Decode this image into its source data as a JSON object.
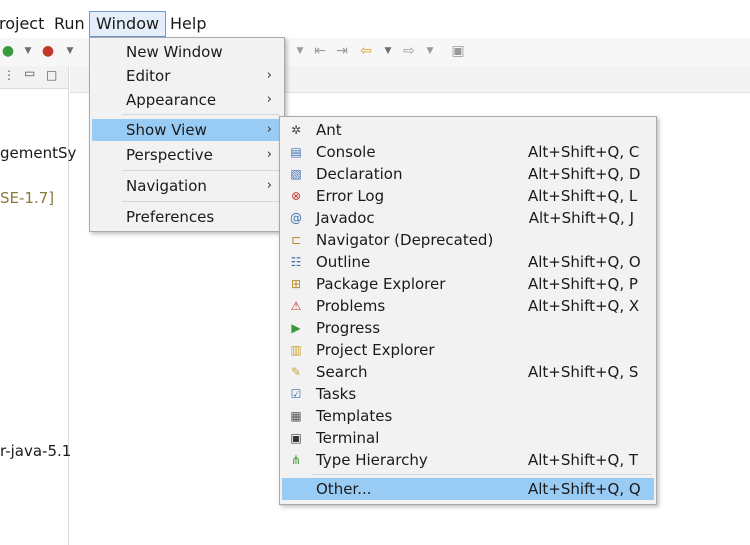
{
  "menubar": {
    "project": "roject",
    "run": "Run",
    "window": "Window",
    "help": "Help"
  },
  "left_texts": {
    "line1": "gementSy",
    "line2": "SE-1.7]",
    "line3": "r-java-5.1"
  },
  "window_menu": [
    {
      "label": "New Window",
      "submenu": false
    },
    {
      "label": "Editor",
      "submenu": true
    },
    {
      "label": "Appearance",
      "submenu": true
    },
    {
      "label": "Show View",
      "submenu": true,
      "selected": true
    },
    {
      "label": "Perspective",
      "submenu": true
    },
    {
      "label": "Navigation",
      "submenu": true
    },
    {
      "label": "Preferences",
      "submenu": false
    }
  ],
  "arrow_glyph": "›",
  "show_view_menu": [
    {
      "label": "Ant",
      "shortcut": "",
      "icon": "ant-icon"
    },
    {
      "label": "Console",
      "shortcut": "Alt+Shift+Q, C",
      "icon": "console-icon"
    },
    {
      "label": "Declaration",
      "shortcut": "Alt+Shift+Q, D",
      "icon": "declaration-icon"
    },
    {
      "label": "Error Log",
      "shortcut": "Alt+Shift+Q, L",
      "icon": "error-log-icon"
    },
    {
      "label": "Javadoc",
      "shortcut": "Alt+Shift+Q, J",
      "icon": "javadoc-icon"
    },
    {
      "label": "Navigator (Deprecated)",
      "shortcut": "",
      "icon": "navigator-icon"
    },
    {
      "label": "Outline",
      "shortcut": "Alt+Shift+Q, O",
      "icon": "outline-icon"
    },
    {
      "label": "Package Explorer",
      "shortcut": "Alt+Shift+Q, P",
      "icon": "package-explorer-icon"
    },
    {
      "label": "Problems",
      "shortcut": "Alt+Shift+Q, X",
      "icon": "problems-icon"
    },
    {
      "label": "Progress",
      "shortcut": "",
      "icon": "progress-icon"
    },
    {
      "label": "Project Explorer",
      "shortcut": "",
      "icon": "project-explorer-icon"
    },
    {
      "label": "Search",
      "shortcut": "Alt+Shift+Q, S",
      "icon": "search-icon"
    },
    {
      "label": "Tasks",
      "shortcut": "",
      "icon": "tasks-icon"
    },
    {
      "label": "Templates",
      "shortcut": "",
      "icon": "templates-icon"
    },
    {
      "label": "Terminal",
      "shortcut": "",
      "icon": "terminal-icon"
    },
    {
      "label": "Type Hierarchy",
      "shortcut": "Alt+Shift+Q, T",
      "icon": "type-hierarchy-icon"
    },
    {
      "label": "Other...",
      "shortcut": "Alt+Shift+Q, Q",
      "icon": "",
      "selected": true
    }
  ],
  "colors": {
    "selection": "#99ccf5",
    "menu_bg": "#f2f2f2",
    "menubar_active_border": "#6f9ad4"
  }
}
